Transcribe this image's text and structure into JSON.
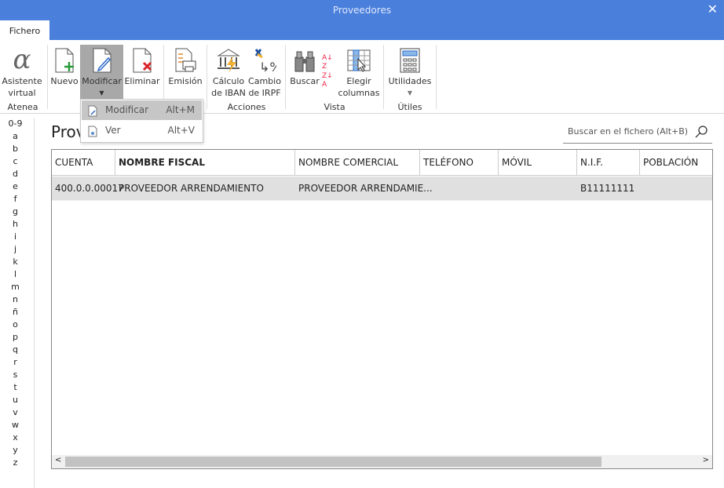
{
  "window": {
    "title": "Proveedores"
  },
  "tabs": [
    {
      "label": "Fichero"
    }
  ],
  "ribbon": {
    "buttons": [
      {
        "label1": "Asistente",
        "label2": "virtual"
      },
      {
        "label1": "Nuevo"
      },
      {
        "label1": "Modificar"
      },
      {
        "label1": "Eliminar"
      },
      {
        "label1": "Emisión"
      },
      {
        "label1": "Cálculo",
        "label2": "de IBAN"
      },
      {
        "label1": "Cambio",
        "label2": "de IRPF"
      },
      {
        "label1": "Buscar"
      },
      {
        "label1": "Elegir",
        "label2": "columnas"
      },
      {
        "label1": "Utilidades"
      }
    ],
    "groups": [
      "Atenea",
      "Acciones",
      "Vista",
      "Útiles"
    ]
  },
  "dropdown": {
    "items": [
      {
        "label": "Modificar",
        "shortcut": "Alt+M"
      },
      {
        "label": "Ver",
        "shortcut": "Alt+V"
      }
    ]
  },
  "alphabet": [
    "0-9",
    "a",
    "b",
    "c",
    "d",
    "e",
    "f",
    "g",
    "h",
    "i",
    "j",
    "k",
    "l",
    "m",
    "n",
    "ñ",
    "o",
    "p",
    "q",
    "r",
    "s",
    "t",
    "u",
    "v",
    "w",
    "x",
    "y",
    "z"
  ],
  "page": {
    "title": "Proveedores"
  },
  "search": {
    "placeholder": "Buscar en el fichero (Alt+B)"
  },
  "table": {
    "columns": [
      "CUENTA",
      "NOMBRE FISCAL",
      "NOMBRE COMERCIAL",
      "TELÉFONO",
      "MÓVIL",
      "N.I.F.",
      "POBLACIÓN"
    ],
    "rows": [
      [
        "400.0.0.00017",
        "PROVEEDOR ARRENDAMIENTO",
        "PROVEEDOR ARRENDAMIE...",
        "",
        "",
        "B11111111",
        ""
      ]
    ]
  },
  "colors": {
    "titlebar": "#4a7fdc",
    "selected_row": "#e0e0e0"
  }
}
